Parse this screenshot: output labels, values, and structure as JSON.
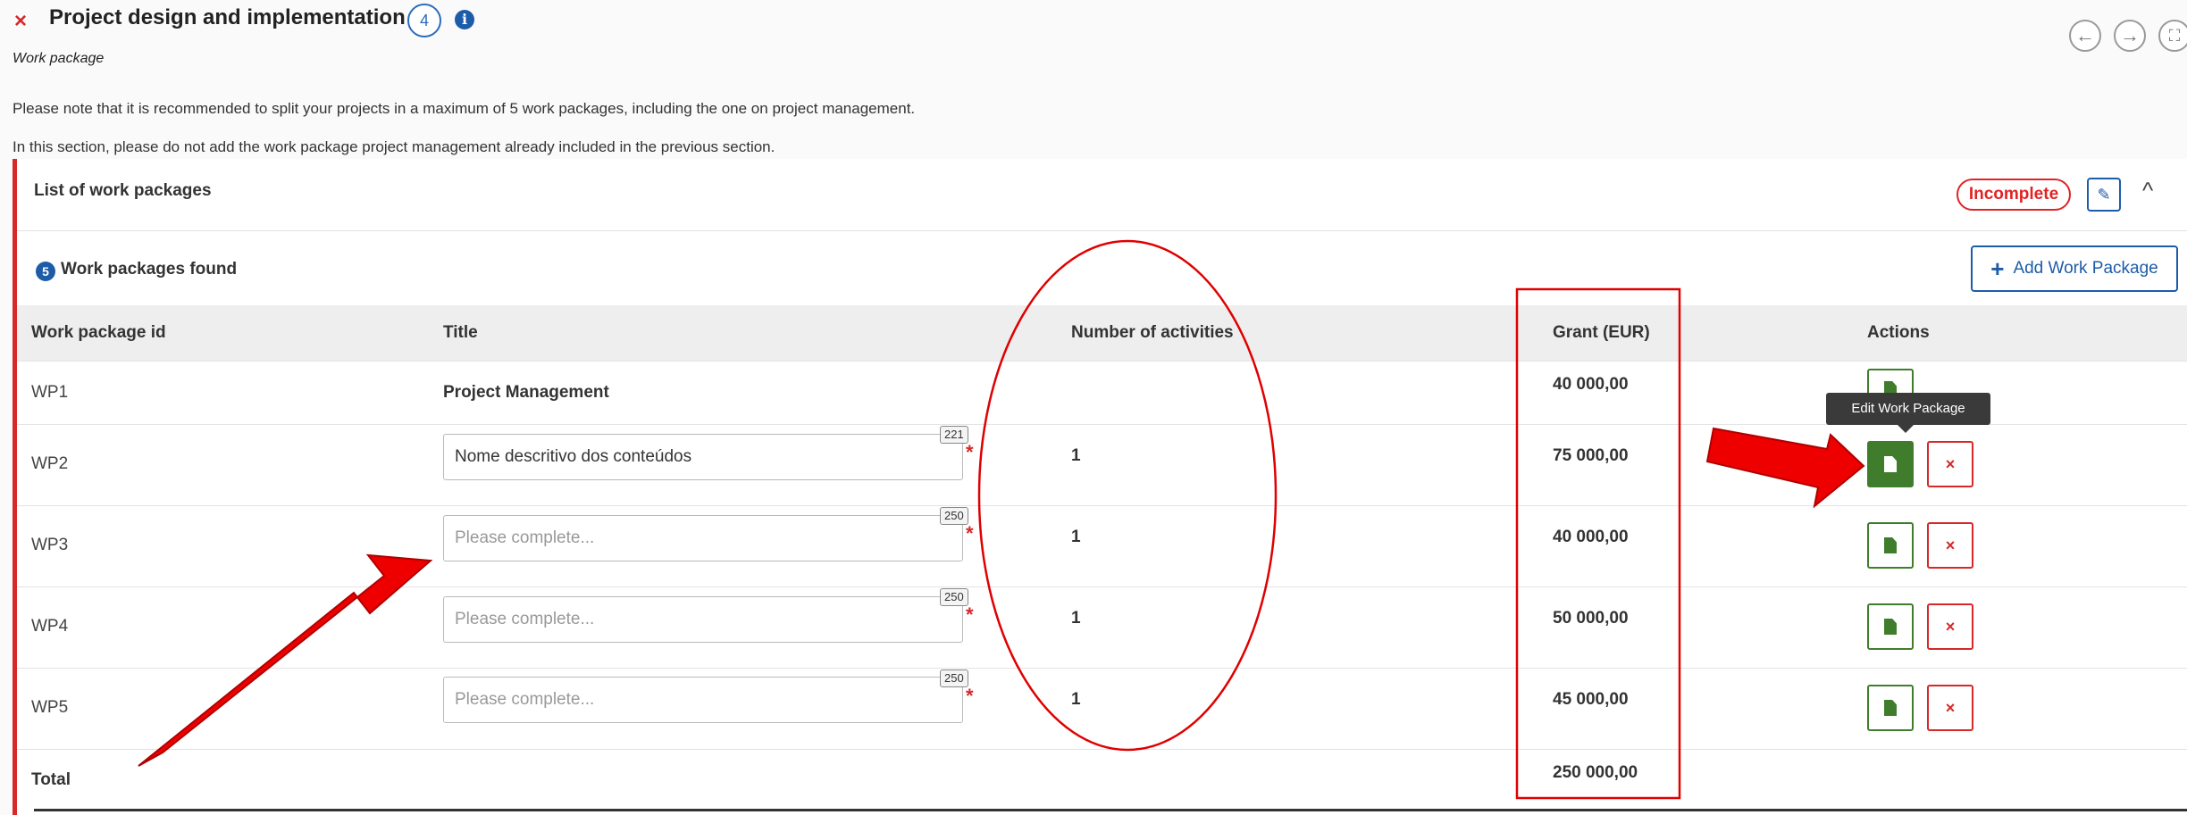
{
  "header": {
    "status_mark": "×",
    "title": "Project design and implementation",
    "count": "4",
    "info": "i",
    "subtitle": "Work package",
    "nav_prev": "←",
    "nav_next": "→",
    "nav_expand": "⛶"
  },
  "notes": [
    "Please note that it is recommended to split your projects in a maximum of 5 work packages, including the one on project management.",
    "In this section, please do not add the work package project management already included in the previous section."
  ],
  "section": {
    "title": "List of work packages",
    "status": "Incomplete",
    "edit_icon": "✎",
    "collapse_icon": "^",
    "found_count": "5",
    "found_label": "Work packages found",
    "add_plus": "+",
    "add_label": "Add Work Package"
  },
  "table": {
    "headers": [
      "Work package id",
      "Title",
      "Number of activities",
      "Grant (EUR)",
      "Actions"
    ],
    "rows": [
      {
        "id": "WP1",
        "title": "Project Management",
        "activities": "",
        "grant": "40 000,00"
      },
      {
        "id": "WP2",
        "title_value": "Nome descritivo dos conteúdos",
        "counter": "221",
        "activities": "1",
        "grant": "75 000,00"
      },
      {
        "id": "WP3",
        "placeholder": "Please complete...",
        "counter": "250",
        "activities": "1",
        "grant": "40 000,00"
      },
      {
        "id": "WP4",
        "placeholder": "Please complete...",
        "counter": "250",
        "activities": "1",
        "grant": "50 000,00"
      },
      {
        "id": "WP5",
        "placeholder": "Please complete...",
        "counter": "250",
        "activities": "1",
        "grant": "45 000,00"
      }
    ],
    "total_label": "Total",
    "total_grant": "250 000,00",
    "required_mark": "*",
    "delete_icon": "×"
  },
  "tooltip": "Edit Work Package",
  "annotation_colors": {
    "highlight": "#e00000",
    "arrow": "#ee0000"
  }
}
